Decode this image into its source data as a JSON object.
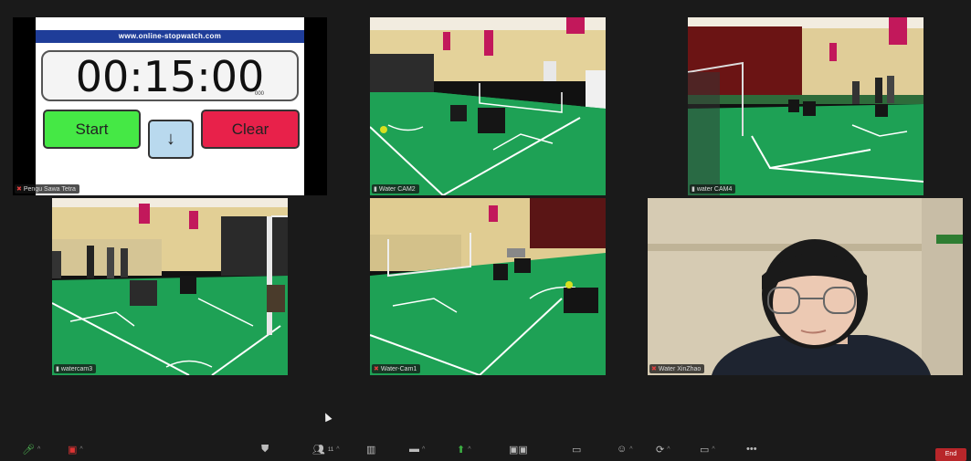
{
  "stopwatch": {
    "site": "www.online-stopwatch.com",
    "time": "00:15:00",
    "ms": "000",
    "start_label": "Start",
    "down_label": "↓",
    "clear_label": "Clear"
  },
  "participants": [
    {
      "name": "Pengu Sawa Tetra",
      "muted": true
    },
    {
      "name": "Water CAM2",
      "muted": false
    },
    {
      "name": "water CAM4",
      "muted": false
    },
    {
      "name": "watercam3",
      "muted": false
    },
    {
      "name": "Water-Cam1",
      "muted": true
    },
    {
      "name": "Water XinZhao",
      "muted": true
    }
  ],
  "toolbar": {
    "participants_count": "11",
    "end_label": "End"
  },
  "colors": {
    "field": "#1ea155",
    "wall": "#d9c48a",
    "banner": "#c2185b",
    "end": "#b8262a"
  }
}
